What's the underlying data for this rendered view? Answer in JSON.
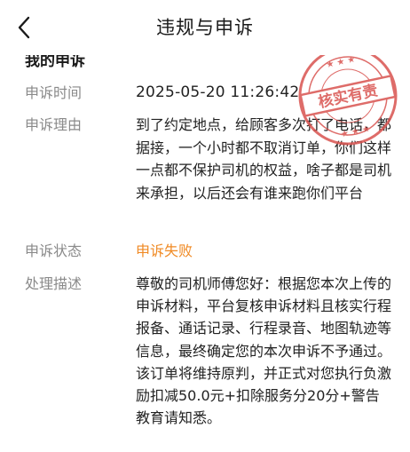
{
  "header": {
    "title": "违规与申诉"
  },
  "section": {
    "title": "我的申诉"
  },
  "stamp": {
    "text": "核实有责",
    "color": "#d9534f"
  },
  "rows": [
    {
      "label": "申诉时间",
      "value": "2025-05-20 11:26:42"
    },
    {
      "label": "申诉理由",
      "value": "到了约定地点，给顾客多次打了电话，都据接，一个小时都不取消订单，你们这样一点都不保护司机的权益，啥子都是司机来承担，以后还会有谁来跑你们平台"
    },
    {
      "label": "申诉状态",
      "value": "申诉失败"
    },
    {
      "label": "处理描述",
      "value": "尊敬的司机师傅您好：根据您本次上传的申诉材料，平台复核申诉材料且核实行程报备、通话记录、行程录音、地图轨迹等信息，最终确定您的本次申诉不予通过。\n该订单将维持原判，并正式对您执行负激励扣减50.0元+扣除服务分20分+警告教育请知悉。"
    }
  ],
  "colors": {
    "status": "#f08a24",
    "label": "#8a8a8a",
    "text": "#222222"
  }
}
